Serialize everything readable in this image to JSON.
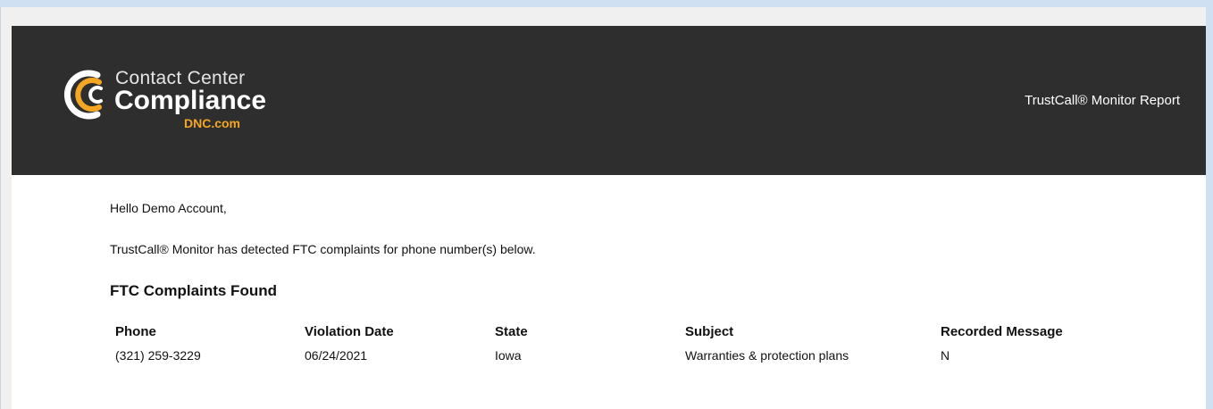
{
  "header": {
    "logo_line1": "Contact Center",
    "logo_line2": "Compliance",
    "logo_line3": "DNC.com",
    "logo_icon": "cc-swoosh-logo",
    "report_title": "TrustCall® Monitor Report",
    "banner_color": "#2e2e2e",
    "accent_color": "#f5a623"
  },
  "body": {
    "greeting": "Hello Demo Account,",
    "intro": "TrustCall® Monitor has detected FTC complaints for phone number(s) below.",
    "section_heading": "FTC Complaints Found"
  },
  "table": {
    "headers": {
      "phone": "Phone",
      "violation_date": "Violation Date",
      "state": "State",
      "subject": "Subject",
      "recorded_message": "Recorded Message"
    },
    "rows": [
      {
        "phone": "(321) 259-3229",
        "violation_date": "06/24/2021",
        "state": "Iowa",
        "subject": "Warranties & protection plans",
        "recorded_message": "N"
      }
    ]
  }
}
